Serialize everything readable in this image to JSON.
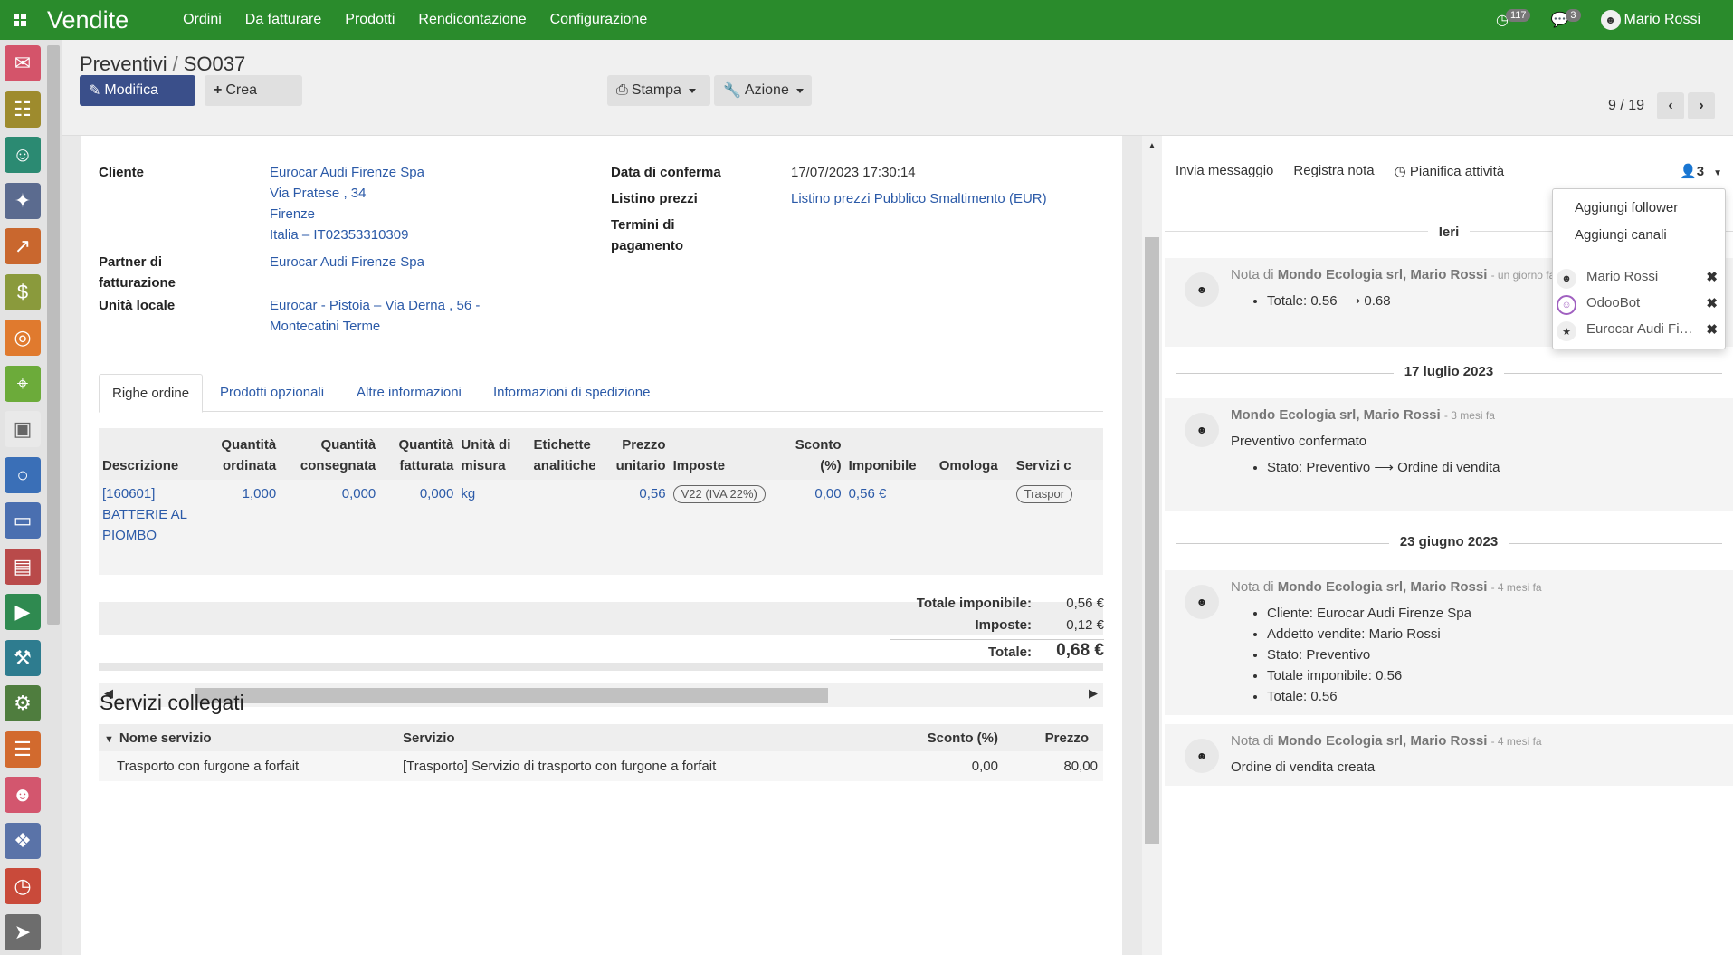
{
  "topbar": {
    "app_title": "Vendite",
    "menu": [
      "Ordini",
      "Da fatturare",
      "Prodotti",
      "Rendicontazione",
      "Configurazione"
    ],
    "activity_count": "117",
    "message_count": "3",
    "user_name": "Mario Rossi"
  },
  "sidebar": {
    "apps": [
      {
        "icon": "discuss-icon",
        "color": "#d4546a"
      },
      {
        "icon": "calendar-icon",
        "color": "#9e8b2d"
      },
      {
        "icon": "contacts-icon",
        "color": "#2b8a72"
      },
      {
        "icon": "crm-handshake-icon",
        "color": "#5b6b8f"
      },
      {
        "icon": "sales-chart-icon",
        "color": "#c9672e"
      },
      {
        "icon": "dashboard-dollar-icon",
        "color": "#8a9a3c"
      },
      {
        "icon": "website-globe-icon",
        "color": "#e07a2e"
      },
      {
        "icon": "map-icon",
        "color": "#6cab3a"
      },
      {
        "icon": "image-icon",
        "color": "#e9e9e9"
      },
      {
        "icon": "helpdesk-lifebuoy-icon",
        "color": "#3a6fb7"
      },
      {
        "icon": "pos-card-icon",
        "color": "#4a6fb0"
      },
      {
        "icon": "inventory-box-icon",
        "color": "#b94a4a"
      },
      {
        "icon": "delivery-truck-icon",
        "color": "#2f8a50"
      },
      {
        "icon": "tools-wrench-icon",
        "color": "#2e7c8f"
      },
      {
        "icon": "settings-tools-icon",
        "color": "#4f7d3e"
      },
      {
        "icon": "invoice-document-icon",
        "color": "#d26a2e"
      },
      {
        "icon": "employees-icon",
        "color": "#d3566e"
      },
      {
        "icon": "apps-puzzle-icon",
        "color": "#5a73a8"
      },
      {
        "icon": "timer-icon",
        "color": "#c94a3a"
      },
      {
        "icon": "send-plane-icon",
        "color": "#6d6d6d"
      }
    ]
  },
  "control": {
    "breadcrumb_parent": "Preventivi",
    "breadcrumb_sep": "/",
    "breadcrumb_current": "SO037",
    "edit_label": "Modifica",
    "create_label": "Crea",
    "print_label": "Stampa",
    "action_label": "Azione",
    "pager": "9 / 19"
  },
  "form": {
    "cliente_label": "Cliente",
    "cliente_lines": [
      "Eurocar Audi Firenze Spa",
      "Via Pratese , 34",
      "Firenze",
      "Italia – IT02353310309"
    ],
    "partner_label": [
      "Partner di",
      "fatturazione"
    ],
    "partner_value": "Eurocar Audi Firenze Spa",
    "unita_label": "Unità locale",
    "unita_lines": [
      "Eurocar - Pistoia – Via Derna , 56 -",
      "Montecatini Terme"
    ],
    "data_label": "Data di conferma",
    "data_value": "17/07/2023 17:30:14",
    "listino_label": "Listino prezzi",
    "listino_value": "Listino prezzi Pubblico Smaltimento (EUR)",
    "termini_label": [
      "Termini di",
      "pagamento"
    ]
  },
  "tabs": [
    "Righe ordine",
    "Prodotti opzionali",
    "Altre informazioni",
    "Informazioni di spedizione"
  ],
  "lines": {
    "headers": [
      [
        "Descrizione"
      ],
      [
        "Quantità",
        "ordinata"
      ],
      [
        "Quantità",
        "consegnata"
      ],
      [
        "Quantità",
        "fatturata"
      ],
      [
        "Unità di",
        "misura"
      ],
      [
        "Etichette",
        "analitiche"
      ],
      [
        "Prezzo",
        "unitario"
      ],
      [
        "Imposte"
      ],
      [
        "Sconto",
        "(%)"
      ],
      [
        "Imponibile"
      ],
      [
        "Omologa"
      ],
      [
        "Servizi c"
      ]
    ],
    "row": {
      "descrizione": [
        "[160601]",
        "BATTERIE AL",
        "PIOMBO"
      ],
      "qta_ordinata": "1,000",
      "qta_consegnata": "0,000",
      "qta_fatturata": "0,000",
      "unita": "kg",
      "etichette": "",
      "prezzo": "0,56",
      "imposte": "V22 (IVA 22%)",
      "sconto": "0,00",
      "imponibile": "0,56 €",
      "omologa": "",
      "servizi": "Traspor"
    }
  },
  "totals": {
    "imponibile_label": "Totale imponibile:",
    "imponibile_value": "0,56 €",
    "imposte_label": "Imposte:",
    "imposte_value": "0,12 €",
    "totale_label": "Totale:",
    "totale_value": "0,68 €"
  },
  "services": {
    "title": "Servizi collegati",
    "headers": [
      "Nome servizio",
      "Servizio",
      "Sconto (%)",
      "Prezzo"
    ],
    "row": [
      "Trasporto con furgone a forfait",
      "[Trasporto] Servizio di trasporto con furgone a forfait",
      "0,00",
      "80,00"
    ]
  },
  "chatter": {
    "send_message": "Invia messaggio",
    "log_note": "Registra nota",
    "schedule": "Pianifica attività",
    "followers_count": "3",
    "dates": [
      "Ieri",
      "17 luglio 2023",
      "23 giugno 2023"
    ],
    "messages": [
      {
        "prefix": "Nota di",
        "author": "Mondo Ecologia srl, Mario Rossi",
        "time": "- un giorno fa",
        "items": [
          "Totale: 0.56 ⟶ 0.68"
        ]
      },
      {
        "prefix": "",
        "author": "Mondo Ecologia srl, Mario Rossi",
        "time": "- 3 mesi fa",
        "text": "Preventivo confermato",
        "items": [
          "Stato: Preventivo ⟶ Ordine di vendita"
        ]
      },
      {
        "prefix": "Nota di",
        "author": "Mondo Ecologia srl, Mario Rossi",
        "time": "- 4 mesi fa",
        "items": [
          "Cliente: Eurocar Audi Firenze Spa",
          "Addetto vendite: Mario Rossi",
          "Stato: Preventivo",
          "Totale imponibile: 0.56",
          "Totale: 0.56"
        ]
      },
      {
        "prefix": "Nota di",
        "author": "Mondo Ecologia srl, Mario Rossi",
        "time": "- 4 mesi fa",
        "text": "Ordine di vendita creata"
      }
    ]
  },
  "followers_dropdown": {
    "add_follower": "Aggiungi follower",
    "add_channels": "Aggiungi canali",
    "followers": [
      "Mario Rossi",
      "OdooBot",
      "Eurocar Audi Firenze Spa"
    ]
  }
}
